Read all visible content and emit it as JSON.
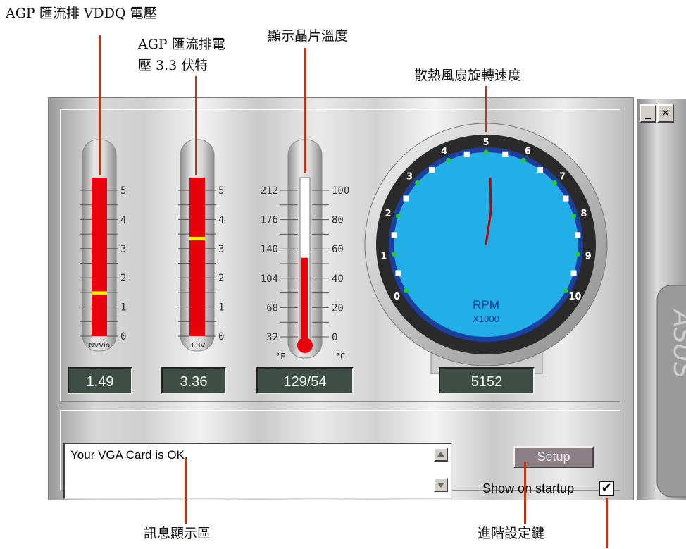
{
  "callouts": {
    "vddq": "AGP 匯流排 VDDQ 電壓",
    "v33": "AGP 匯流排電\n壓 3.3 伏特",
    "temp": "顯示晶片溫度",
    "fan": "散熱風扇旋轉速度",
    "message": "訊息顯示區",
    "setup": "進階設定鍵"
  },
  "window": {
    "minimize_label": "_",
    "close_label": "×",
    "brand": "ASUS"
  },
  "vddq_meter": {
    "label": "NVVio",
    "scale": [
      "5",
      "4",
      "3",
      "2",
      "1",
      "0"
    ],
    "value": "1.49",
    "level": 1.49
  },
  "v33_meter": {
    "label": "3.3V",
    "scale": [
      "5",
      "4",
      "3",
      "2",
      "1",
      "0"
    ],
    "value": "3.36",
    "level": 3.36
  },
  "thermometer": {
    "scale_f": [
      "212",
      "176",
      "140",
      "104",
      "68",
      "32"
    ],
    "scale_c": [
      "100",
      "80",
      "60",
      "40",
      "20",
      "0"
    ],
    "unit_f": "°F",
    "unit_c": "°C",
    "value": "129/54",
    "level_c": 54
  },
  "fan_gauge": {
    "dial_numbers": [
      "0",
      "1",
      "2",
      "3",
      "4",
      "5",
      "6",
      "7",
      "8",
      "9",
      "10"
    ],
    "unit": "RPM",
    "multiplier": "X1000",
    "value": "5152",
    "rpm_thousands": 5.152
  },
  "message_box": {
    "text": "Your VGA Card is OK."
  },
  "controls": {
    "setup_label": "Setup",
    "show_on_startup_label": "Show on startup",
    "show_on_startup_checked": "✔"
  },
  "colors": {
    "callout_line": "#b2381e",
    "meter_fill": "#e8000a",
    "meter_marker": "#ffee00",
    "dial_face": "#22aee6",
    "dial_ring": "#1d3fa0",
    "readout_bg": "#3e4e46"
  }
}
